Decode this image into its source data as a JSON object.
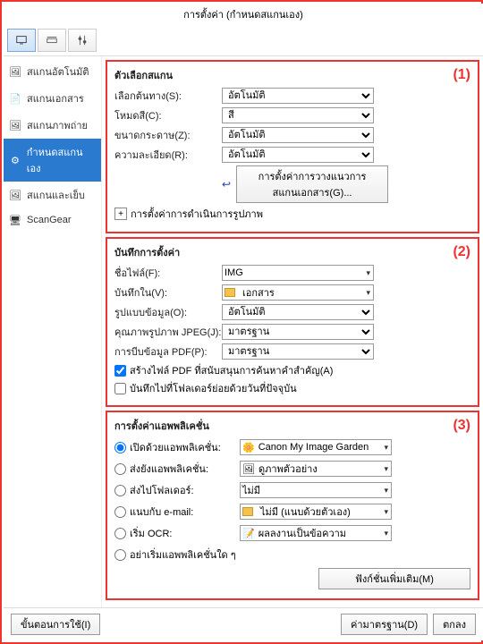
{
  "window": {
    "title": "การตั้งค่า (กำหนดสแกนเอง)"
  },
  "sidebar": {
    "items": [
      {
        "label": "สแกนอัตโนมัติ"
      },
      {
        "label": "สแกนเอกสาร"
      },
      {
        "label": "สแกนภาพถ่าย"
      },
      {
        "label": "กำหนดสแกนเอง"
      },
      {
        "label": "สแกนและเย็บ"
      },
      {
        "label": "ScanGear"
      }
    ]
  },
  "section1": {
    "num": "(1)",
    "title": "ตัวเลือกสแกน",
    "source_label": "เลือกต้นทาง(S):",
    "source_value": "อัตโนมัติ",
    "colormode_label": "โหมดสี(C):",
    "colormode_value": "สี",
    "papersize_label": "ขนาดกระดาษ(Z):",
    "papersize_value": "อัตโนมัติ",
    "resolution_label": "ความละเอียด(R):",
    "resolution_value": "อัตโนมัติ",
    "docscan_btn": "การตั้งค่าการวางแนวการสแกนเอกสาร(G)...",
    "imgproc_label": "การตั้งค่าการดำเนินการรูปภาพ"
  },
  "section2": {
    "num": "(2)",
    "title": "บันทึกการตั้งค่า",
    "filename_label": "ชื่อไฟล์(F):",
    "filename_value": "IMG",
    "savein_label": "บันทึกใน(V):",
    "savein_value": "เอกสาร",
    "format_label": "รูปแบบข้อมูล(O):",
    "format_value": "อัตโนมัติ",
    "jpeg_label": "คุณภาพรูปภาพ JPEG(J):",
    "jpeg_value": "มาตรฐาน",
    "pdf_label": "การบีบข้อมูล PDF(P):",
    "pdf_value": "มาตรฐาน",
    "chk1": "สร้างไฟล์ PDF ที่สนับสนุนการค้นหาคำสำคัญ(A)",
    "chk2": "บันทึกไปที่โฟลเดอร์ย่อยด้วยวันที่ปัจจุบัน"
  },
  "section3": {
    "num": "(3)",
    "title": "การตั้งค่าแอพพลิเคชั่น",
    "r1_label": "เปิดด้วยแอพพลิเคชั่น:",
    "r1_value": "Canon My Image Garden",
    "r2_label": "ส่งยังแอพพลิเคชั่น:",
    "r2_value": "ดูภาพตัวอย่าง",
    "r3_label": "ส่งไปโฟลเดอร์:",
    "r3_value": "ไม่มี",
    "r4_label": "แนบกับ e-mail:",
    "r4_value": "ไม่มี (แนบด้วยตัวเอง)",
    "r5_label": "เริ่ม OCR:",
    "r5_value": "ผลลงานเป็นข้อความ",
    "r6_label": "อย่าเริ่มแอพพลิเคชั่นใด ๆ",
    "more_btn": "ฟังก์ชั่นเพิ่มเติม(M)"
  },
  "footer": {
    "instructions": "ขั้นตอนการใช้(I)",
    "defaults": "ค่ามาตรฐาน(D)",
    "ok": "ตกลง"
  }
}
